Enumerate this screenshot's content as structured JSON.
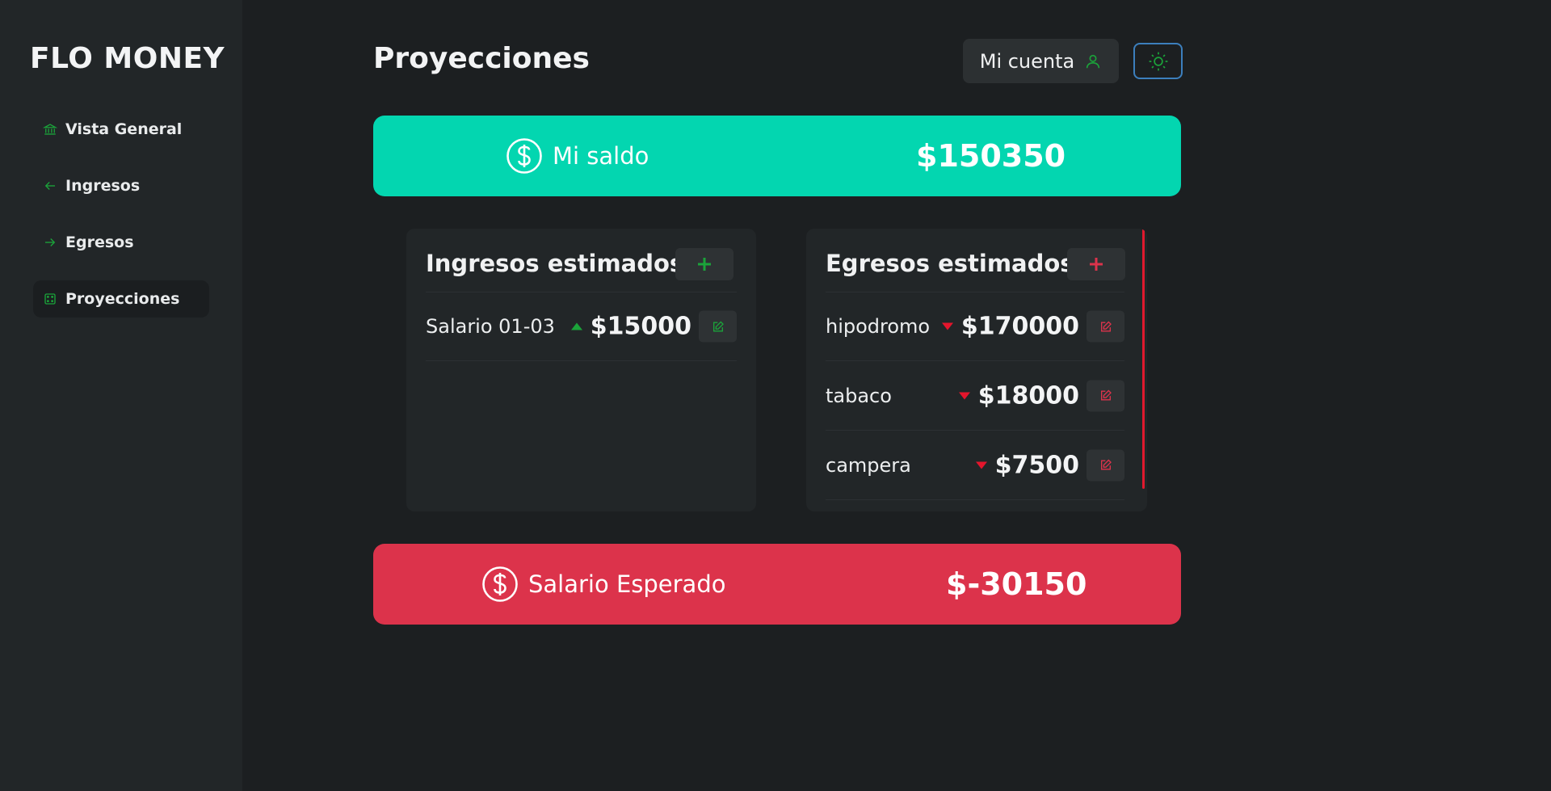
{
  "app": {
    "brand": "FLO MONEY"
  },
  "sidebar": {
    "items": [
      {
        "label": "Vista General",
        "icon": "bank-icon"
      },
      {
        "label": "Ingresos",
        "icon": "arrow-left-icon"
      },
      {
        "label": "Egresos",
        "icon": "arrow-right-icon"
      },
      {
        "label": "Proyecciones",
        "icon": "dice-icon",
        "active": true
      }
    ]
  },
  "header": {
    "title": "Proyecciones",
    "account_label": "Mi cuenta",
    "account_icon": "user-icon",
    "theme_icon": "sun-icon"
  },
  "balance": {
    "label": "Mi saldo",
    "amount": "$150350",
    "icon": "dollar-circle-icon"
  },
  "income": {
    "title": "Ingresos estimados",
    "add_icon": "plus-icon",
    "items": [
      {
        "name": "Salario 01-03",
        "amount": "$15000",
        "trend": "up"
      }
    ]
  },
  "expenses": {
    "title": "Egresos estimados",
    "add_icon": "plus-icon",
    "items": [
      {
        "name": "hipodromo",
        "amount": "$170000",
        "trend": "down"
      },
      {
        "name": "tabaco",
        "amount": "$18000",
        "trend": "down"
      },
      {
        "name": "campera",
        "amount": "$7500",
        "trend": "down"
      }
    ]
  },
  "expected": {
    "label": "Salario Esperado",
    "amount": "$-30150",
    "icon": "dollar-circle-icon"
  },
  "colors": {
    "background": "#1c1f21",
    "sidebar": "#222628",
    "accent_green": "#1ba33a",
    "balance_banner": "#03d6b0",
    "expected_banner": "#dc334b",
    "expense_red": "#e4152c",
    "theme_border": "#3c7fbd"
  }
}
